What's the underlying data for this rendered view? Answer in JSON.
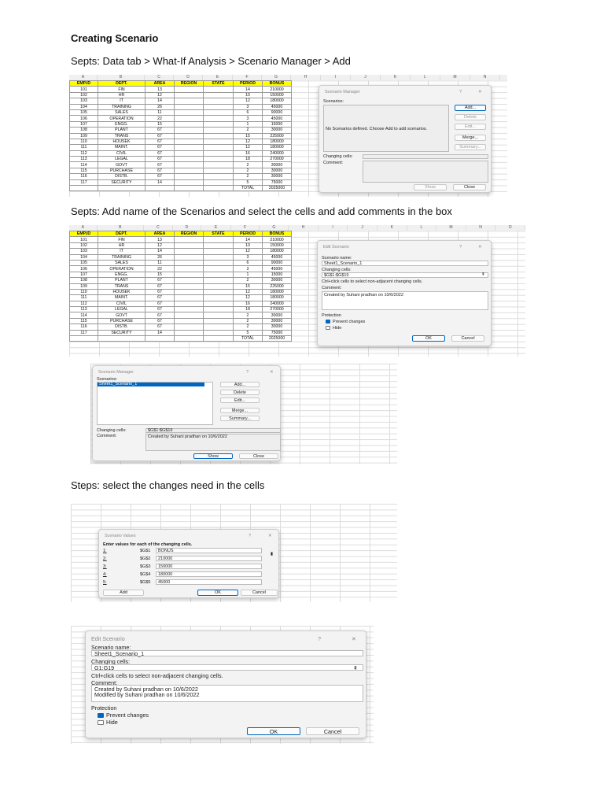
{
  "headings": {
    "title": "Creating Scenario",
    "step1": "Septs: Data tab > What-If Analysis > Scenario Manager > Add",
    "step2": "Septs: Add name of the Scenarios and select the cells and add comments in the box",
    "step3": "Steps: select the changes need in the cells"
  },
  "sheet": {
    "columns": [
      "A",
      "B",
      "C",
      "D",
      "E",
      "F",
      "G",
      "H",
      "I",
      "J",
      "K",
      "L",
      "M",
      "N",
      "O"
    ],
    "header": [
      "EMP.ID",
      "DEPT.",
      "AREA",
      "REGION",
      "STATE",
      "PERIOD",
      "BONUS"
    ],
    "rows": [
      [
        "101",
        "FIN",
        "13",
        "",
        "",
        "14",
        "210000"
      ],
      [
        "102",
        "HR",
        "12",
        "",
        "",
        "10",
        "150000"
      ],
      [
        "103",
        "IT",
        "14",
        "",
        "",
        "12",
        "180000"
      ],
      [
        "104",
        "TRAINING",
        "26",
        "",
        "",
        "3",
        "45000"
      ],
      [
        "105",
        "SALES",
        "11",
        "",
        "",
        "6",
        "90000"
      ],
      [
        "106",
        "OPERATION",
        "22",
        "",
        "",
        "3",
        "45000"
      ],
      [
        "107",
        "ENGG.",
        "15",
        "",
        "",
        "1",
        "15000"
      ],
      [
        "108",
        "PLANT",
        "67",
        "",
        "",
        "2",
        "30000"
      ],
      [
        "109",
        "TRANS",
        "67",
        "",
        "",
        "15",
        "225000"
      ],
      [
        "110",
        "HOUSEK",
        "67",
        "",
        "",
        "12",
        "180000"
      ],
      [
        "111",
        "MAINT.",
        "67",
        "",
        "",
        "12",
        "180000"
      ],
      [
        "112",
        "CIVIL",
        "67",
        "",
        "",
        "16",
        "240000"
      ],
      [
        "113",
        "LEGAL",
        "67",
        "",
        "",
        "18",
        "270000"
      ],
      [
        "114",
        "GOVT",
        "67",
        "",
        "",
        "2",
        "30000"
      ],
      [
        "115",
        "PURCHASE",
        "67",
        "",
        "",
        "2",
        "30000"
      ],
      [
        "116",
        "DISTB.",
        "67",
        "",
        "",
        "2",
        "30000"
      ],
      [
        "117",
        "SECURITY",
        "14",
        "",
        "",
        "5",
        "75000"
      ],
      [
        "",
        "",
        "",
        "",
        "",
        "TOTAL",
        "2025000"
      ]
    ]
  },
  "manager1": {
    "title": "Scenario Manager",
    "help": "?",
    "close": "✕",
    "scenarios_label": "Scenarios:",
    "empty": "No Scenarios defined. Choose Add to add scenarios.",
    "add": "Add...",
    "delete": "Delete",
    "edit": "Edit...",
    "merge": "Merge...",
    "summary": "Summary...",
    "changing_label": "Changing cells:",
    "comment_label": "Comment:",
    "show": "Show",
    "close_btn": "Close"
  },
  "edit1": {
    "title": "Edit Scenario",
    "help": "?",
    "close": "✕",
    "name_label": "Scenario name:",
    "name": "Sheet1_Scenario_1",
    "cells_label": "Changing cells:",
    "cells": "$G$1:$G$19",
    "hint": "Ctrl+click cells to select non-adjacent changing cells.",
    "comment_label": "Comment:",
    "comment": "Created by Suhani pradhan on 10/6/2022",
    "protection": "Protection",
    "prevent": "Prevent changes",
    "hide": "Hide",
    "ok": "OK",
    "cancel": "Cancel"
  },
  "manager2": {
    "title": "Scenario Manager",
    "help": "?",
    "close": "✕",
    "scenarios_label": "Scenarios:",
    "selected": "Sheet1_Scenario_1",
    "add": "Add...",
    "delete": "Delete",
    "edit": "Edit...",
    "merge": "Merge...",
    "summary": "Summary...",
    "changing_label": "Changing cells:",
    "changing": "$G$1:$G$19",
    "comment_label": "Comment:",
    "comment": "Created by Suhani pradhan on 10/6/2022",
    "show": "Show",
    "close_btn": "Close"
  },
  "values": {
    "title": "Scenario Values",
    "help": "?",
    "close": "✕",
    "prompt": "Enter values for each of the changing cells.",
    "items": [
      {
        "n": "1:",
        "ref": "$G$1",
        "v": "BONUS"
      },
      {
        "n": "2:",
        "ref": "$G$2",
        "v": "210000"
      },
      {
        "n": "3:",
        "ref": "$G$3",
        "v": "150000"
      },
      {
        "n": "4:",
        "ref": "$G$4",
        "v": "180000"
      },
      {
        "n": "5:",
        "ref": "$G$5",
        "v": "45000"
      }
    ],
    "add": "Add",
    "ok": "OK",
    "cancel": "Cancel"
  },
  "edit2": {
    "title": "Edit Scenario",
    "help": "?",
    "close": "✕",
    "name_label": "Scenario name:",
    "name": "Sheet1_Scenario_1",
    "cells_label": "Changing cells:",
    "cells": "G1:G19",
    "hint": "Ctrl+click cells to select non-adjacent changing cells.",
    "comment_label": "Comment:",
    "comment1": "Created by Suhani pradhan on 10/6/2022",
    "comment2": "Modified by Suhani pradhan on 10/6/2022",
    "protection": "Protection",
    "prevent": "Prevent changes",
    "hide": "Hide",
    "ok": "OK",
    "cancel": "Cancel"
  }
}
